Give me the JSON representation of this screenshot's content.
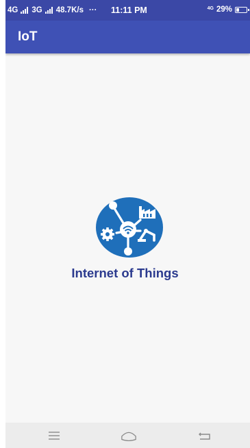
{
  "status_bar": {
    "network_1": "4G",
    "network_2": "3G",
    "speed": "48.7K/s",
    "more": "···",
    "time": "11:11 PM",
    "lte_label": "4G",
    "battery_percent_text": "29%",
    "battery_level": 0.29
  },
  "app_bar": {
    "title": "IoT"
  },
  "splash": {
    "logo_icon": "internet-of-things-logo",
    "brand_text": "Internet of Things"
  },
  "nav_bar": {
    "icons": [
      "menu-icon",
      "home-icon",
      "back-icon"
    ]
  },
  "colors": {
    "status_bar": "#3b48a6",
    "app_bar": "#3f51b5",
    "logo_blue": "#1f6fba",
    "brand_text": "#2b3a8e",
    "background": "#f7f7f7",
    "nav_bar": "#ececec"
  }
}
